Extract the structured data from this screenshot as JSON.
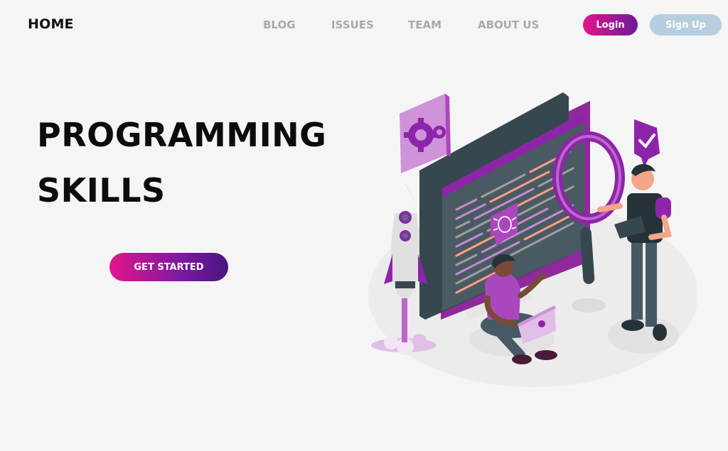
{
  "header": {
    "brand": "HOME",
    "nav": [
      "BLOG",
      "ISSUES",
      "TEAM",
      "ABOUT US"
    ],
    "login_label": "Login",
    "signup_label": "Sign Up"
  },
  "hero": {
    "title_line1": "PROGRAMMING",
    "title_line2": "SKILLS",
    "cta_label": "GET STARTED"
  },
  "colors": {
    "accent_pink": "#e3158c",
    "accent_purple": "#6a1b9a",
    "signup_blue": "#b7cee0",
    "nav_gray": "#a9a9a9",
    "illustration_purple": "#9c27b0",
    "monitor_dark": "#37474f"
  }
}
